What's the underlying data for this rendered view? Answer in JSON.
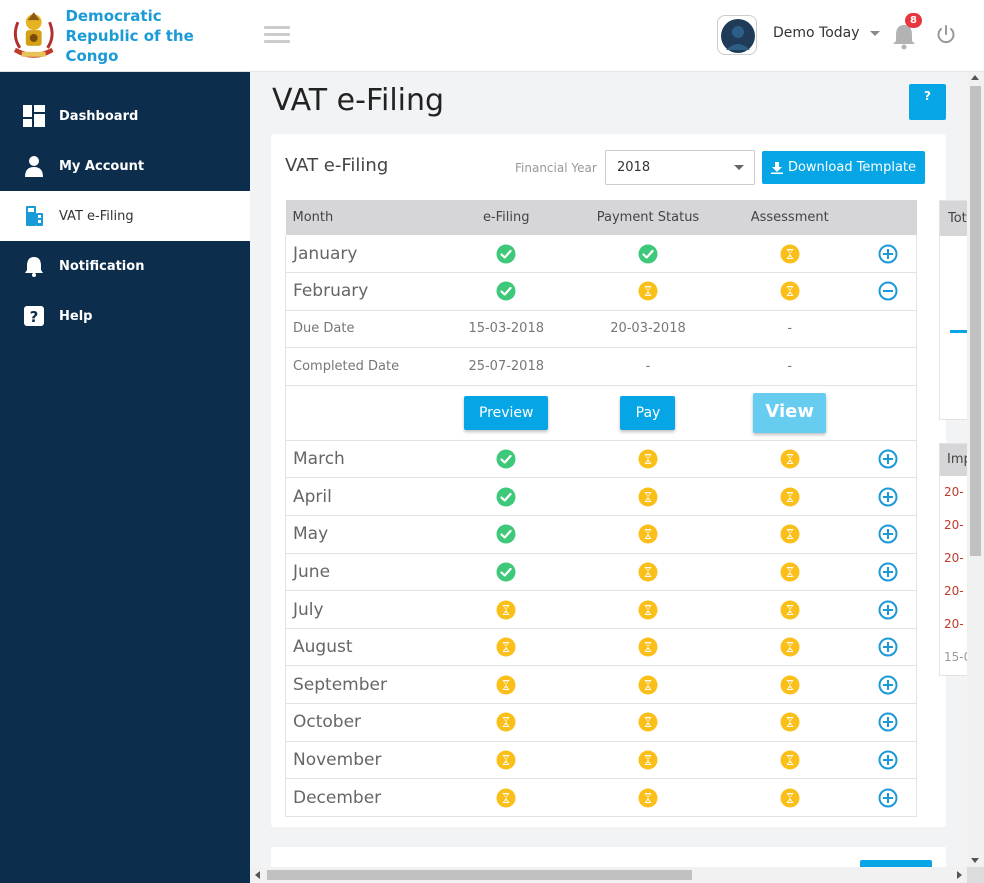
{
  "brand": {
    "line1": "Democratic",
    "line2": "Republic of the Congo"
  },
  "topbar": {
    "user_name": "Demo Today",
    "notification_count": "8"
  },
  "sidebar": {
    "items": [
      {
        "label": "Dashboard",
        "icon": "dashboard-icon"
      },
      {
        "label": "My Account",
        "icon": "user-icon"
      },
      {
        "label": "VAT e-Filing",
        "icon": "calculator-icon",
        "active": true
      },
      {
        "label": "Notification",
        "icon": "bell-icon"
      },
      {
        "label": "Help",
        "icon": "question-icon"
      }
    ]
  },
  "page": {
    "title": "VAT e-Filing",
    "help_label": "?"
  },
  "card": {
    "title": "VAT e-Filing",
    "fy_label": "Financial Year",
    "fy_value": "2018",
    "download_label": "Download Template"
  },
  "table": {
    "headers": [
      "Month",
      "e-Filing",
      "Payment Status",
      "Assessment"
    ],
    "expanded": {
      "due_label": "Due Date",
      "due": [
        "15-03-2018",
        "20-03-2018",
        "-"
      ],
      "completed_label": "Completed Date",
      "completed": [
        "25-07-2018",
        "-",
        "-"
      ],
      "preview_label": "Preview",
      "pay_label": "Pay",
      "view_label": "View"
    },
    "rows": [
      {
        "month": "January",
        "efiling": "done",
        "payment": "done",
        "assessment": "pending",
        "expanded": false
      },
      {
        "month": "February",
        "efiling": "done",
        "payment": "pending",
        "assessment": "pending",
        "expanded": true
      },
      {
        "month": "March",
        "efiling": "done",
        "payment": "pending",
        "assessment": "pending",
        "expanded": false
      },
      {
        "month": "April",
        "efiling": "done",
        "payment": "pending",
        "assessment": "pending",
        "expanded": false
      },
      {
        "month": "May",
        "efiling": "done",
        "payment": "pending",
        "assessment": "pending",
        "expanded": false
      },
      {
        "month": "June",
        "efiling": "done",
        "payment": "pending",
        "assessment": "pending",
        "expanded": false
      },
      {
        "month": "July",
        "efiling": "pending",
        "payment": "pending",
        "assessment": "pending",
        "expanded": false
      },
      {
        "month": "August",
        "efiling": "pending",
        "payment": "pending",
        "assessment": "pending",
        "expanded": false
      },
      {
        "month": "September",
        "efiling": "pending",
        "payment": "pending",
        "assessment": "pending",
        "expanded": false
      },
      {
        "month": "October",
        "efiling": "pending",
        "payment": "pending",
        "assessment": "pending",
        "expanded": false
      },
      {
        "month": "November",
        "efiling": "pending",
        "payment": "pending",
        "assessment": "pending",
        "expanded": false
      },
      {
        "month": "December",
        "efiling": "pending",
        "payment": "pending",
        "assessment": "pending",
        "expanded": false
      }
    ]
  },
  "side_panel_top": {
    "header": "Tot"
  },
  "side_panel_bottom": {
    "header": "Imp",
    "rows": [
      {
        "text": "20-",
        "color": "#c0392b"
      },
      {
        "text": "20-",
        "color": "#c0392b"
      },
      {
        "text": "20-",
        "color": "#c0392b"
      },
      {
        "text": "20-",
        "color": "#c0392b"
      },
      {
        "text": "20-",
        "color": "#c0392b"
      },
      {
        "text": "15-0",
        "color": "#999999"
      }
    ]
  },
  "colors": {
    "accent": "#06a6e6",
    "sidebar": "#0d2d4d",
    "done": "#3ec97a",
    "pending": "#fbbf1a"
  }
}
